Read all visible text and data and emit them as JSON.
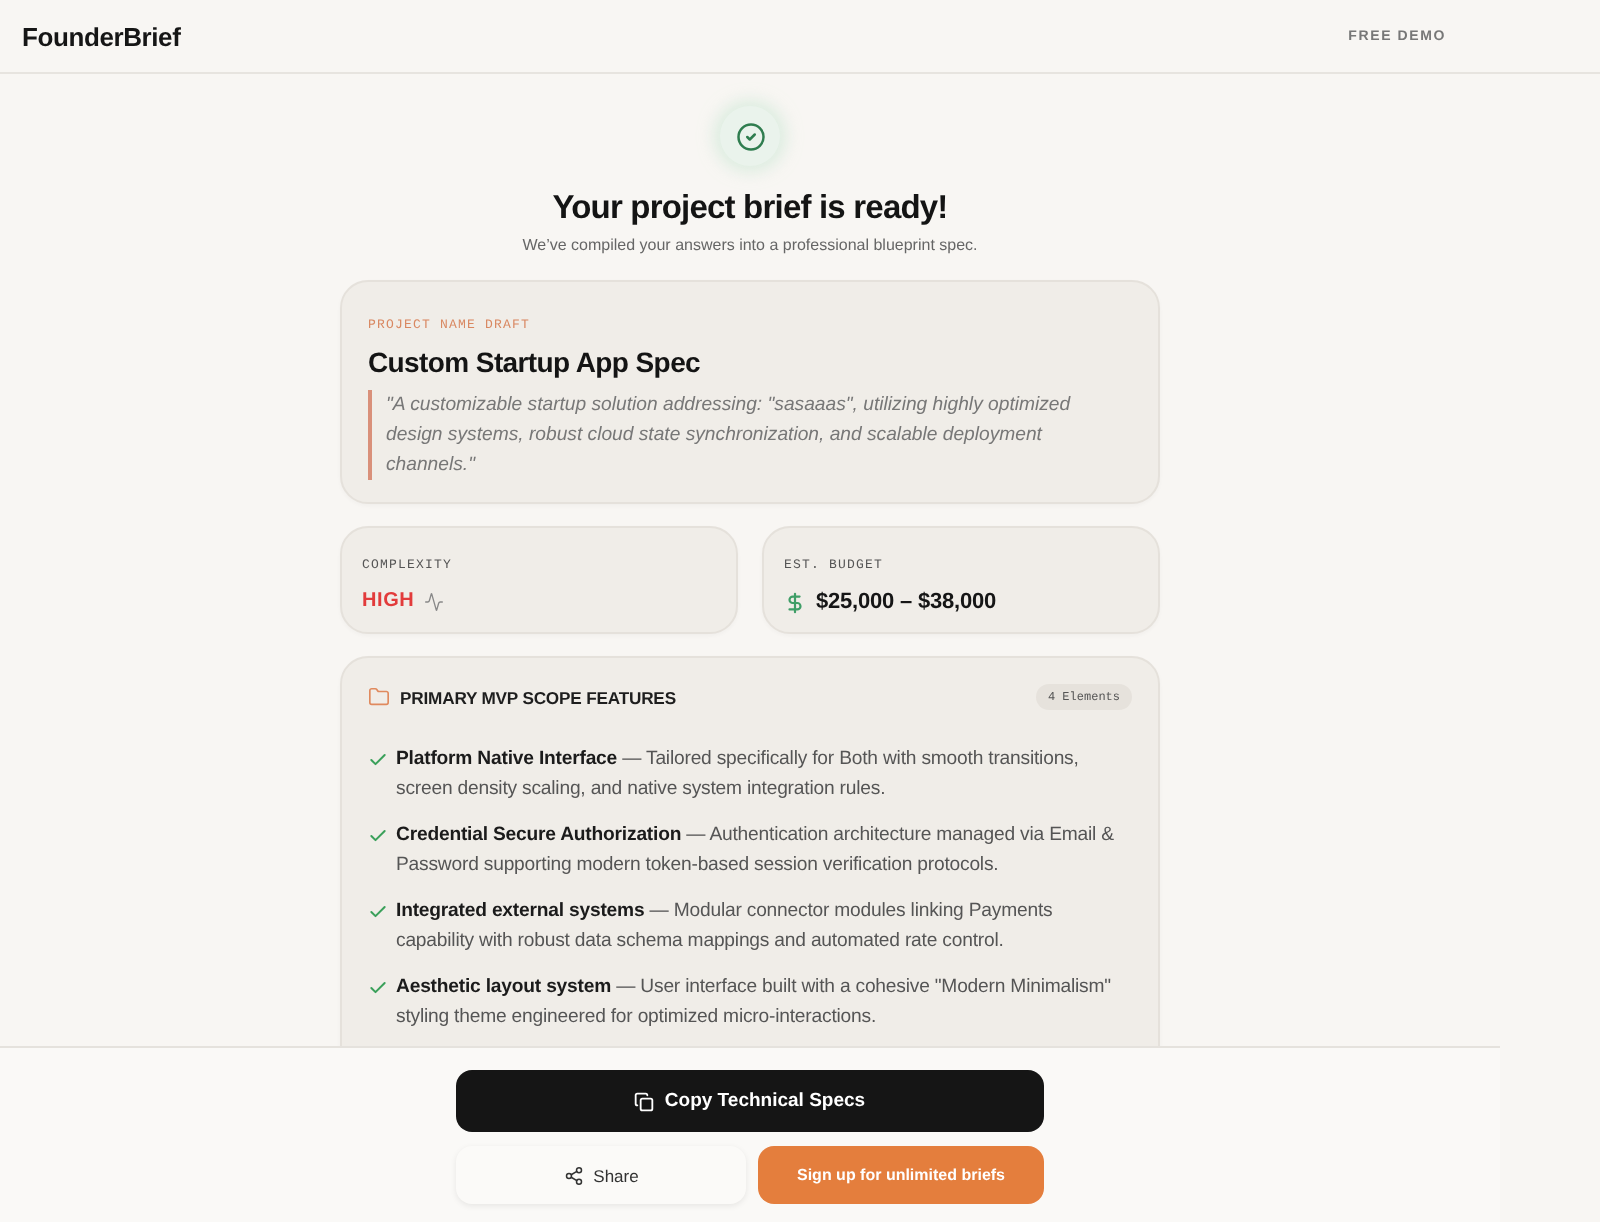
{
  "header": {
    "logo": "FounderBrief",
    "badge": "FREE DEMO"
  },
  "hero": {
    "title": "Your project brief is ready!",
    "subtitle": "We’ve compiled your answers into a professional blueprint spec."
  },
  "project": {
    "label": "PROJECT NAME DRAFT",
    "name": "Custom Startup App Spec",
    "description": "\"A customizable startup solution addressing: \"sasaaas\", utilizing highly optimized design systems, robust cloud state synchronization, and scalable deployment channels.\""
  },
  "metrics": [
    {
      "kind": "complexity",
      "label": "COMPLEXITY",
      "value": "HIGH"
    },
    {
      "kind": "budget",
      "label": "EST. BUDGET",
      "value": "$25,000 – $38,000"
    }
  ],
  "features": {
    "title": "PRIMARY MVP SCOPE FEATURES",
    "count": "4 Elements",
    "items": [
      "**Platform Native Interface** — Tailored specifically for Both with smooth transitions, screen density scaling, and native system integration rules.",
      "**Credential Secure Authorization** — Authentication architecture managed via Email & Password supporting modern token-based session verification protocols.",
      "**Integrated external systems** — Modular connector modules linking Payments capability with robust data schema mappings and automated rate control.",
      "**Aesthetic layout system** — User interface built with a cohesive \"Modern Minimalism\" styling theme engineered for optimized micro-interactions."
    ]
  },
  "actions": [
    {
      "kind": "copy",
      "label": "Copy Technical Specs"
    },
    {
      "kind": "share",
      "label": "Share"
    },
    {
      "kind": "signup",
      "label": "Sign up for unlimited briefs"
    }
  ]
}
